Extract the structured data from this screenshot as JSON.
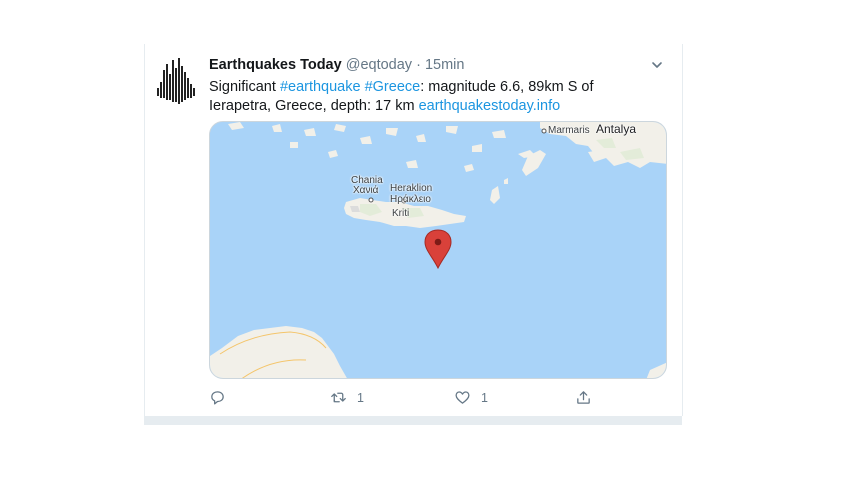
{
  "tweet": {
    "name": "Earthquakes Today",
    "handle": "@eqtoday",
    "separator": "·",
    "time": "15min",
    "text": {
      "prefix": "Significant ",
      "hashtag1": "#earthquake",
      "space": " ",
      "hashtag2": "#Greece",
      "body": ": magnitude 6.6, 89km S of Ierapetra, Greece, depth: 17 km ",
      "url": "earthquakestoday.info"
    }
  },
  "map": {
    "labels": {
      "chania_en": "Chania",
      "chania_gr": "Χανιά",
      "heraklion_en": "Heraklion",
      "heraklion_gr": "Ηράκλειο",
      "kriti": "Kriti",
      "marmaris": "Marmaris",
      "antalya": "Antalya"
    },
    "colors": {
      "sea": "#a9d3f8",
      "land": "#f2f0e9",
      "marker": "#d9413a"
    }
  },
  "actions": {
    "reply_icon": "reply-icon",
    "retweet_icon": "retweet-icon",
    "retweet_count": "1",
    "like_icon": "heart-icon",
    "like_count": "1",
    "share_icon": "share-icon"
  }
}
